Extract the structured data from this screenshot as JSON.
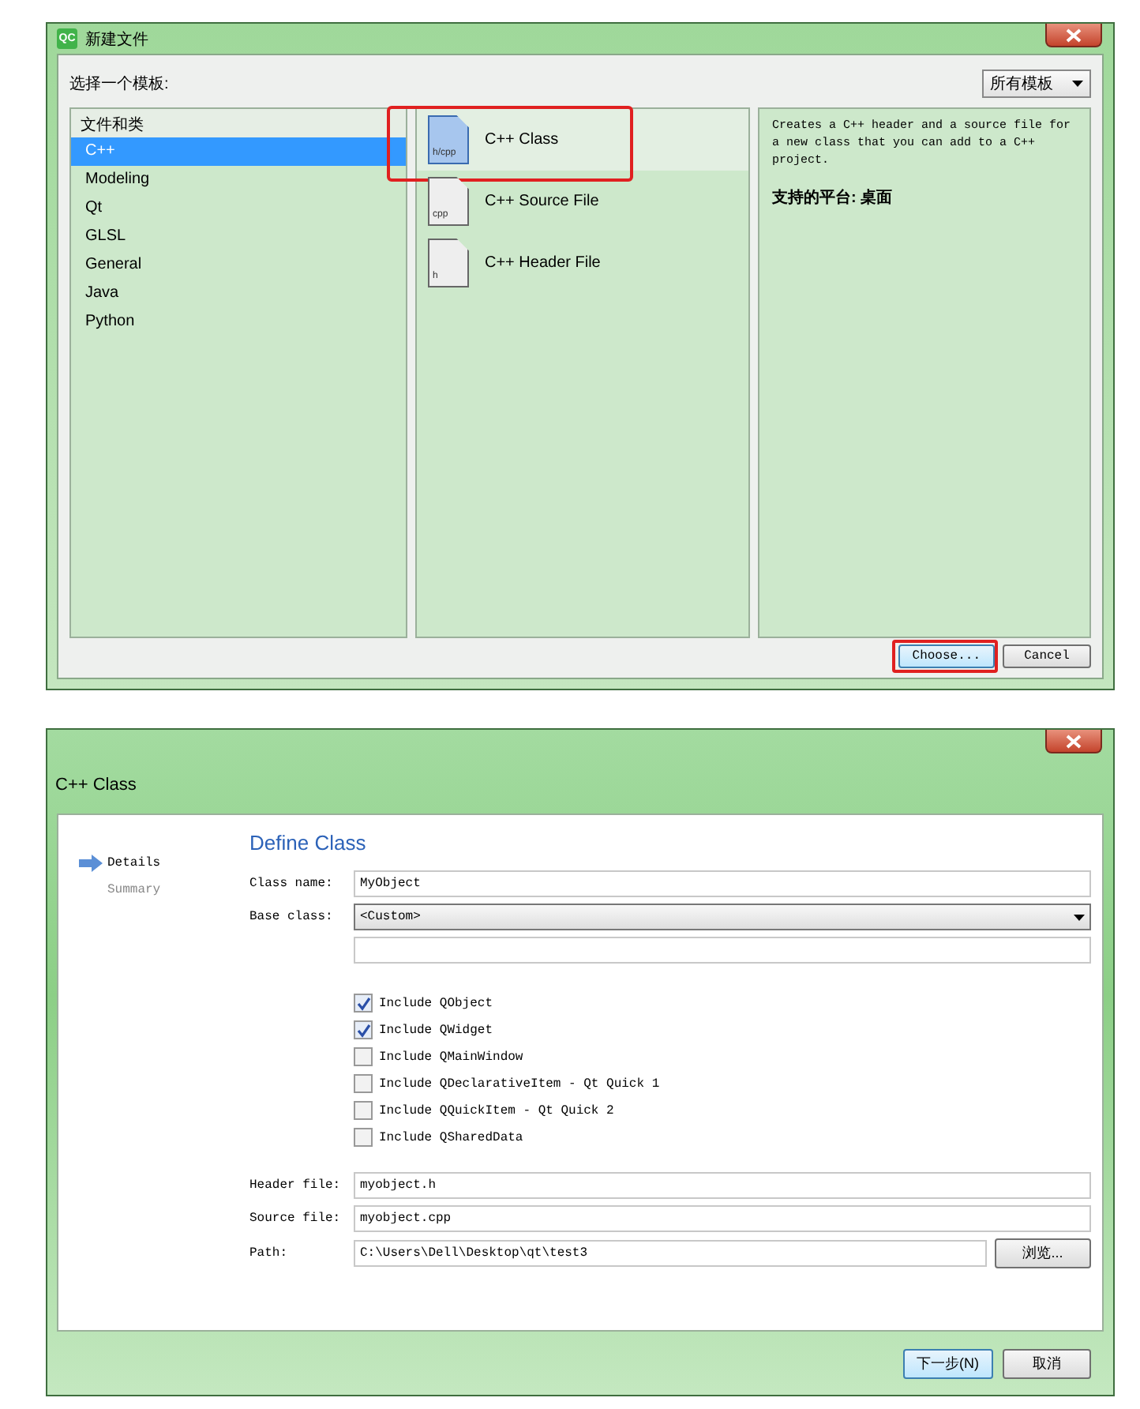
{
  "new_file_dialog": {
    "icon_text": "QC",
    "title": "新建文件",
    "template_label": "选择一个模板:",
    "filter": "所有模板",
    "categories": {
      "header": "文件和类",
      "items": [
        {
          "label": "C++",
          "selected": true
        },
        {
          "label": "Modeling",
          "selected": false
        },
        {
          "label": "Qt",
          "selected": false
        },
        {
          "label": "GLSL",
          "selected": false
        },
        {
          "label": "General",
          "selected": false
        },
        {
          "label": "Java",
          "selected": false
        },
        {
          "label": "Python",
          "selected": false
        }
      ]
    },
    "templates": [
      {
        "label": "C++ Class",
        "icon_text": "h/cpp",
        "selected": true,
        "highlighted": true
      },
      {
        "label": "C++ Source File",
        "icon_text": "cpp",
        "selected": false,
        "highlighted": false
      },
      {
        "label": "C++ Header File",
        "icon_text": "h",
        "selected": false,
        "highlighted": false
      }
    ],
    "description": "Creates a C++ header and a source file for a new class that you can add to a C++ project.",
    "platform_label": "支持的平台:",
    "platform_value": "桌面",
    "buttons": [
      {
        "label": "Choose...",
        "default": true,
        "highlighted": true
      },
      {
        "label": "Cancel",
        "default": false,
        "highlighted": false
      }
    ]
  },
  "class_dialog": {
    "title": "C++ Class",
    "steps": [
      {
        "label": "Details",
        "selected": true
      },
      {
        "label": "Summary",
        "selected": false
      }
    ],
    "heading": "Define Class",
    "class_name": {
      "label": "Class name:",
      "value": "MyObject"
    },
    "base_class": {
      "label": "Base class:",
      "value": "<Custom>"
    },
    "checkboxes": [
      {
        "label": "Include QObject",
        "checked": true
      },
      {
        "label": "Include QWidget",
        "checked": true
      },
      {
        "label": "Include QMainWindow",
        "checked": false
      },
      {
        "label": "Include QDeclarativeItem - Qt Quick 1",
        "checked": false
      },
      {
        "label": "Include QQuickItem - Qt Quick 2",
        "checked": false
      },
      {
        "label": "Include QSharedData",
        "checked": false
      }
    ],
    "files": [
      {
        "label": "Header file:",
        "value": "myobject.h"
      },
      {
        "label": "Source file:",
        "value": "myobject.cpp"
      }
    ],
    "path": {
      "label": "Path:",
      "value": "C:\\Users\\Dell\\Desktop\\qt\\test3",
      "button": "浏览..."
    },
    "buttons": [
      {
        "label": "下一步(N)",
        "default": true
      },
      {
        "label": "取消",
        "default": false
      }
    ]
  }
}
